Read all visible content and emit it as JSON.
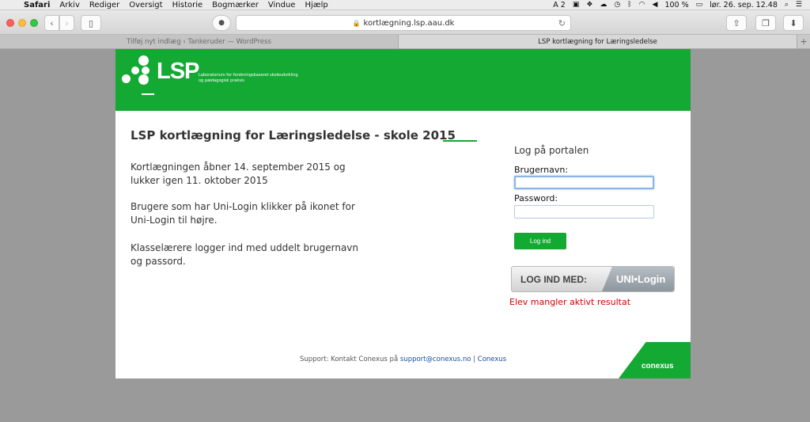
{
  "menubar": {
    "app": "Safari",
    "items": [
      "Arkiv",
      "Rediger",
      "Oversigt",
      "Historie",
      "Bogmærker",
      "Vindue",
      "Hjælp"
    ],
    "status_input": "A 2",
    "battery": "100 %",
    "datetime": "lør. 26. sep. 12.48"
  },
  "toolbar": {
    "url": "kortlægning.lsp.aau.dk"
  },
  "tabs": [
    {
      "label": "Tilføj nyt indlæg ‹ Tankeruder — WordPress",
      "active": false
    },
    {
      "label": "LSP kortlægning for Læringsledelse",
      "active": true
    }
  ],
  "header": {
    "logo": "LSP",
    "subtitle": "Laboratorium for forskningsbaseret skoleudvikling og pædagogisk praksis"
  },
  "main": {
    "title": "LSP kortlægning for Læringsledelse - skole 2015",
    "paragraphs": [
      "Kortlægningen åbner 14. september 2015 og lukker igen 11. oktober 2015",
      "Brugere som har Uni-Login klikker på ikonet for Uni-Login til højre.",
      "Klasselærere logger ind med uddelt brugernavn og passord."
    ]
  },
  "login": {
    "heading": "Log på portalen",
    "username_label": "Brugernavn:",
    "username_value": "",
    "password_label": "Password:",
    "password_value": "",
    "submit_label": "Log ind",
    "unilogin_left": "LOG IND MED:",
    "unilogin_right": "UNI•Login",
    "error": "Elev mangler aktivt resultat"
  },
  "footer": {
    "prefix": "Support: Kontakt Conexus på",
    "email": "support@conexus.no",
    "separator": "|",
    "link": "Conexus",
    "brand": "conexus"
  },
  "colors": {
    "brand_green": "#14a933",
    "error_red": "#d10000"
  }
}
